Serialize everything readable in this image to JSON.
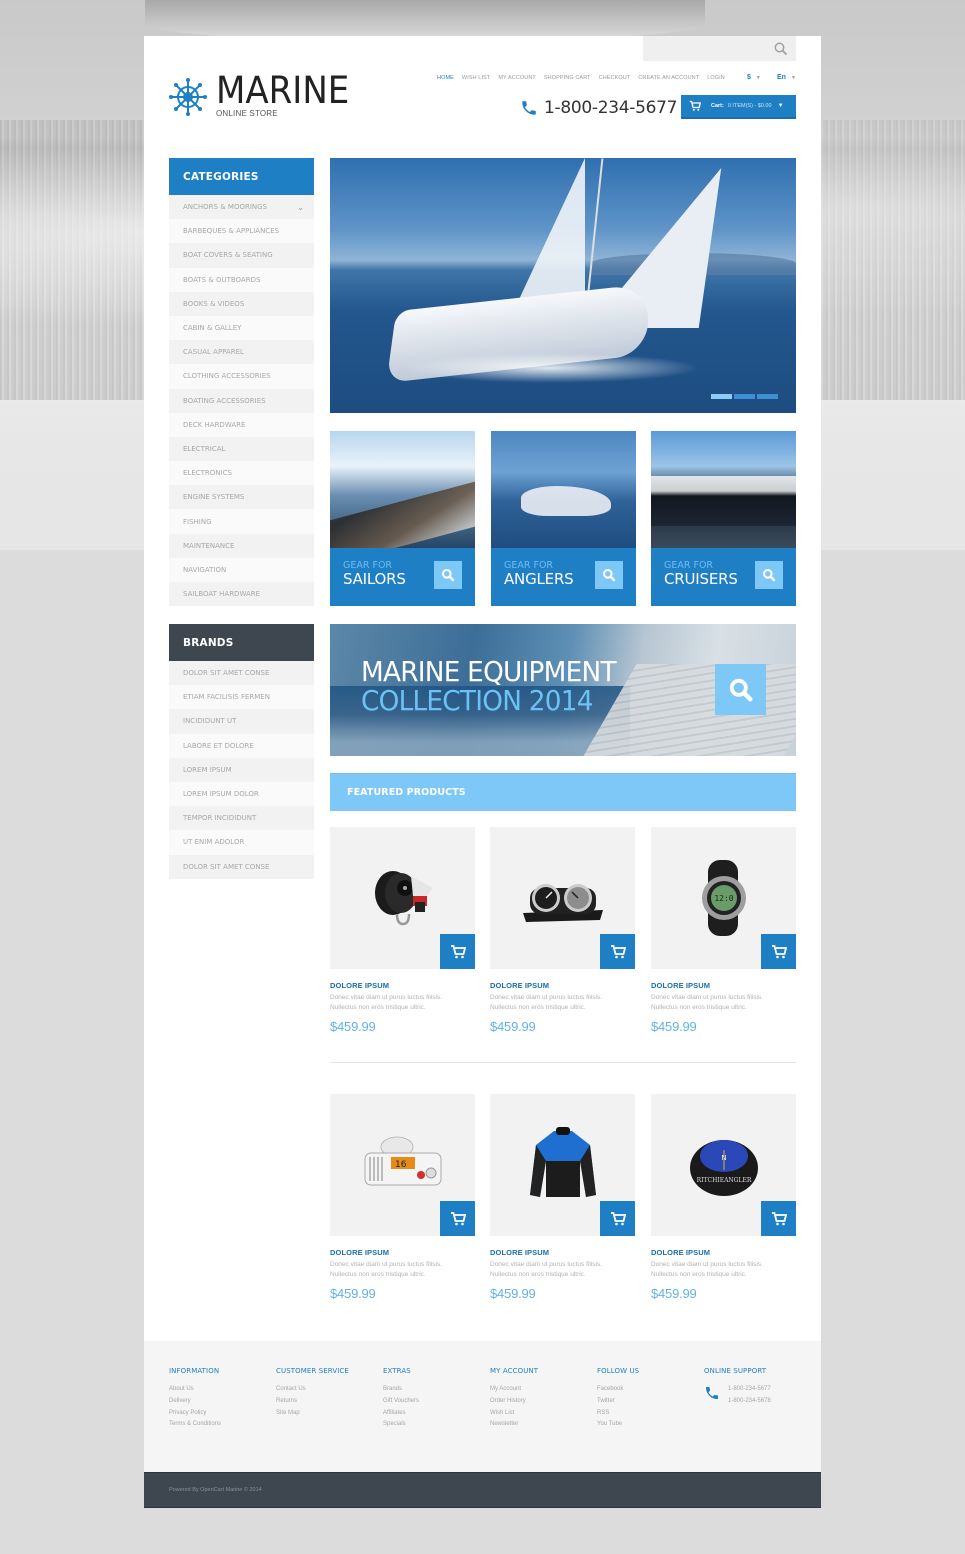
{
  "header": {
    "search": {
      "value": "",
      "placeholder": ""
    },
    "logo": {
      "title": "MARINE",
      "subtitle": "ONLINE STORE"
    },
    "nav": [
      {
        "label": "HOME",
        "active": true
      },
      {
        "label": "WISH LIST",
        "active": false
      },
      {
        "label": "MY ACCOUNT",
        "active": false
      },
      {
        "label": "SHOPPING CART",
        "active": false
      },
      {
        "label": "CHECKOUT",
        "active": false
      },
      {
        "label": "CREATE AN ACCOUNT",
        "active": false
      },
      {
        "label": "LOGIN",
        "active": false
      }
    ],
    "currency": "$",
    "language": "En",
    "phone": "1-800-234-5677",
    "cart": {
      "label": "Cart:",
      "value": "0 ITEM(S) - $0.00"
    }
  },
  "sidebar": {
    "categories": {
      "title": "CATEGORIES",
      "items": [
        "ANCHORS & MOORINGS",
        "BARBEQUES & APPLIANCES",
        "BOAT COVERS & SEATING",
        "BOATS & OUTBOARDS",
        "BOOKS & VIDEOS",
        "CABIN & GALLEY",
        "CASUAL APPAREL",
        "CLOTHING ACCESSORIES",
        "BOATING ACCESSORIES",
        "DECK HARDWARE",
        "ELECTRICAL",
        "ELECTRONICS",
        "ENGINE SYSTEMS",
        "FISHING",
        "MAINTENANCE",
        "NAVIGATION",
        "SAILBOAT HARDWARE"
      ]
    },
    "brands": {
      "title": "BRANDS",
      "items": [
        "DOLOR SIT AMET CONSE",
        "ETIAM FACILISIS FERMEN",
        "INCIDIDUNT UT",
        "LABORE ET DOLORE",
        "LOREM IPSUM",
        "LOREM IPSUM DOLOR",
        "TEMPOR INCIDIDUNT",
        "UT ENIM ADOLOR",
        "DOLOR SIT AMET CONSE"
      ]
    }
  },
  "hero": {
    "slides": 3,
    "active_slide": 1
  },
  "gear_tiles": [
    {
      "small": "GEAR FOR",
      "big": "SAILORS"
    },
    {
      "small": "GEAR FOR",
      "big": "ANGLERS"
    },
    {
      "small": "GEAR FOR",
      "big": "CRUISERS"
    }
  ],
  "collection": {
    "line1": "MARINE EQUIPMENT",
    "line2": "COLLECTION 2014"
  },
  "featured": {
    "title": "FEATURED PRODUCTS",
    "products": [
      {
        "name": "DOLORE IPSUM",
        "desc1": "Donec vitae diam ut purus luctus filisis.",
        "desc2": "Nullectus non eros tristique ultric.",
        "price": "$459.99",
        "image": "sailing-block"
      },
      {
        "name": "DOLORE IPSUM",
        "desc1": "Donec vitae diam ut purus luctus filisis.",
        "desc2": "Nullectus non eros tristique ultric.",
        "price": "$459.99",
        "image": "clock-barometer"
      },
      {
        "name": "DOLORE IPSUM",
        "desc1": "Donec vitae diam ut purus luctus filisis.",
        "desc2": "Nullectus non eros tristique ultric.",
        "price": "$459.99",
        "image": "sport-watch"
      },
      {
        "name": "DOLORE IPSUM",
        "desc1": "Donec vitae diam ut purus luctus filisis.",
        "desc2": "Nullectus non eros tristique ultric.",
        "price": "$459.99",
        "image": "vhf-radio"
      },
      {
        "name": "DOLORE IPSUM",
        "desc1": "Donec vitae diam ut purus luctus filisis.",
        "desc2": "Nullectus non eros tristique ultric.",
        "price": "$459.99",
        "image": "sailing-jacket"
      },
      {
        "name": "DOLORE IPSUM",
        "desc1": "Donec vitae diam ut purus luctus filisis.",
        "desc2": "Nullectus non eros tristique ultric.",
        "price": "$459.99",
        "image": "compass"
      }
    ]
  },
  "footer": {
    "columns": [
      {
        "title": "INFORMATION",
        "links": [
          "About Us",
          "Delivery",
          "Privacy Policy",
          "Terms & Conditions"
        ]
      },
      {
        "title": "CUSTOMER SERVICE",
        "links": [
          "Contact Us",
          "Returns",
          "Site Map"
        ]
      },
      {
        "title": "EXTRAS",
        "links": [
          "Brands",
          "Gift Vouchers",
          "Affiliates",
          "Specials"
        ]
      },
      {
        "title": "MY ACCOUNT",
        "links": [
          "My Account",
          "Order History",
          "Wish List",
          "Newsletter"
        ]
      },
      {
        "title": "FOLLOW US",
        "links": [
          "Facebook",
          "Twitter",
          "RSS",
          "You Tube"
        ]
      }
    ],
    "support": {
      "title": "ONLINE SUPPORT",
      "phones": [
        "1-800-234-5677",
        "1-800-234-5678"
      ]
    },
    "copyright": "Powered By OpenCart Marine © 2014"
  },
  "colors": {
    "primary": "#1e7fc4",
    "light_blue": "#7ec8f7",
    "dark": "#3e4650",
    "price": "#5fb3ea"
  }
}
